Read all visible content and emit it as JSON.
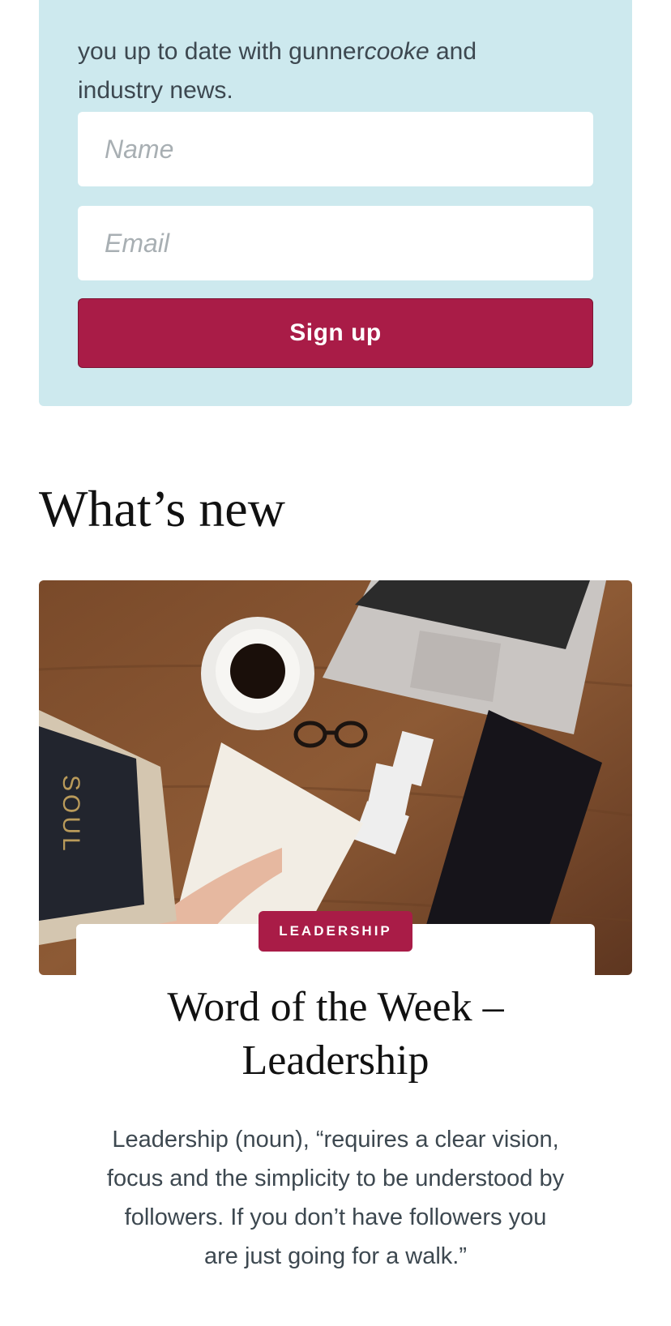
{
  "signup": {
    "intro_before": "you up to date with gunner",
    "intro_italic": "cooke",
    "intro_after": " and industry news.",
    "name_placeholder": "Name",
    "email_placeholder": "Email",
    "button_label": "Sign up"
  },
  "whats_new": {
    "title": "What’s new",
    "article": {
      "category": "LEADERSHIP",
      "title": "Word of the Week – Leadership",
      "excerpt": "Leadership (noun), “requires a clear vision, focus and the simplicity to be understood by followers. If you don’t have followers you are just going for a walk.”",
      "book_spine_text": "SOUL"
    }
  },
  "colors": {
    "accent": "#a91c47",
    "panel_background": "#cde9ee"
  }
}
